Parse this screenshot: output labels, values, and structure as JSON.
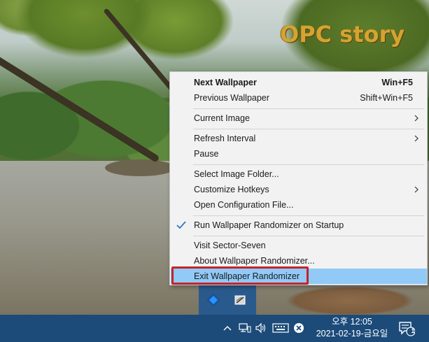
{
  "watermark": "OPC story",
  "menu": {
    "items": [
      {
        "label": "Next Wallpaper",
        "shortcut": "Win+F5"
      },
      {
        "label": "Previous Wallpaper",
        "shortcut": "Shift+Win+F5"
      },
      {
        "label": "Current Image"
      },
      {
        "label": "Refresh Interval"
      },
      {
        "label": "Pause"
      },
      {
        "label": "Select Image Folder..."
      },
      {
        "label": "Customize Hotkeys"
      },
      {
        "label": "Open Configuration File..."
      },
      {
        "label": "Run Wallpaper Randomizer on Startup",
        "checked": true
      },
      {
        "label": "Visit Sector-Seven"
      },
      {
        "label": "About Wallpaper Randomizer..."
      },
      {
        "label": "Exit Wallpaper Randomizer"
      }
    ],
    "highlight_color": "#91c9f7",
    "callout_color": "#c4242b"
  },
  "taskbar": {
    "clock_time": "오후 12:05",
    "clock_date": "2021-02-19-금요일",
    "notification_count": "1",
    "background_color": "#1c4b7a"
  }
}
